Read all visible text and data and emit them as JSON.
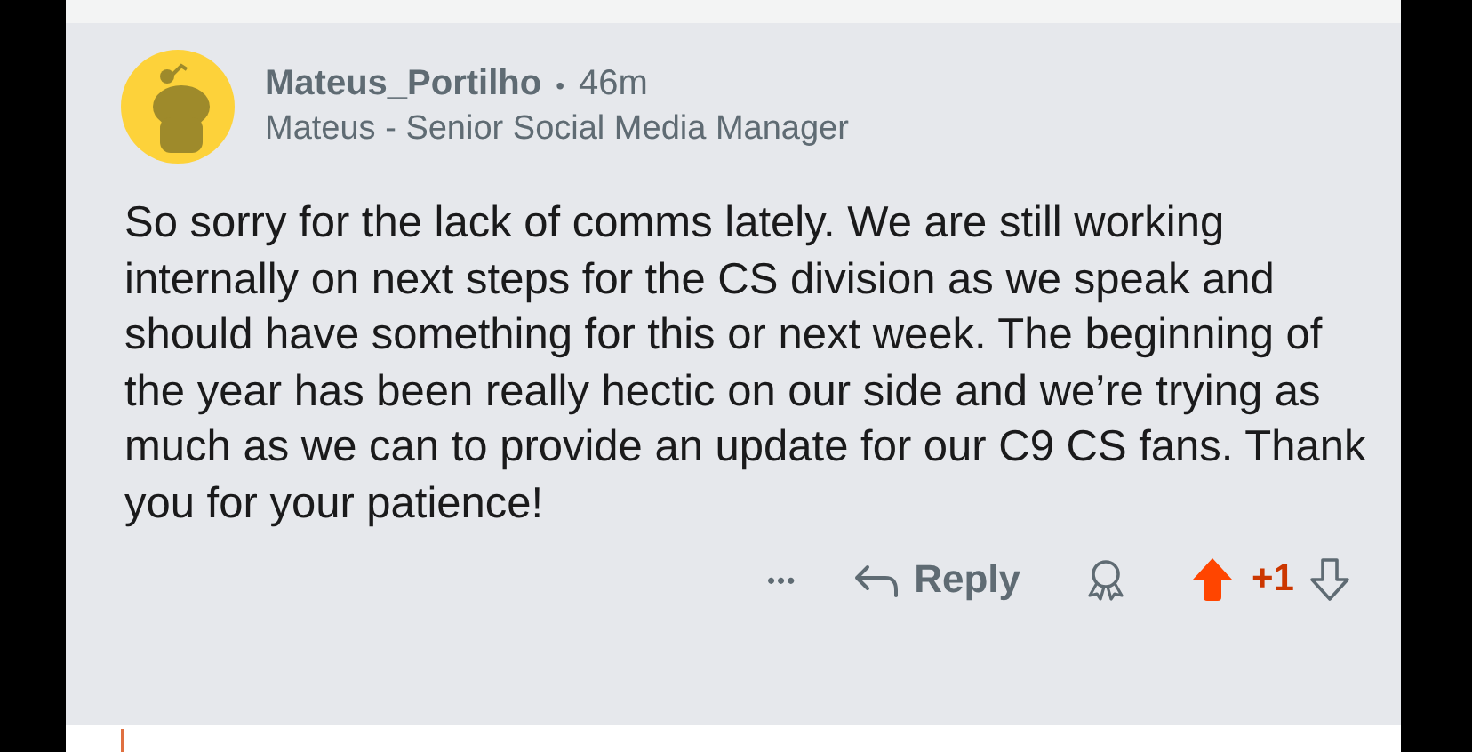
{
  "comment": {
    "author": "Mateus_Portilho",
    "separator": "•",
    "time": "46m",
    "flair": "Mateus - Senior Social Media Manager",
    "body": "So sorry for the lack of comms lately. We are still working internally on next steps for the CS division as we speak and should have something for this or next week. The beginning of the year has been really hectic on our side and we’re trying as much as we can to provide an update for our C9 CS fans. Thank you for your patience!",
    "more": "•••",
    "reply": "Reply",
    "upvoted": true,
    "score": "+1"
  }
}
